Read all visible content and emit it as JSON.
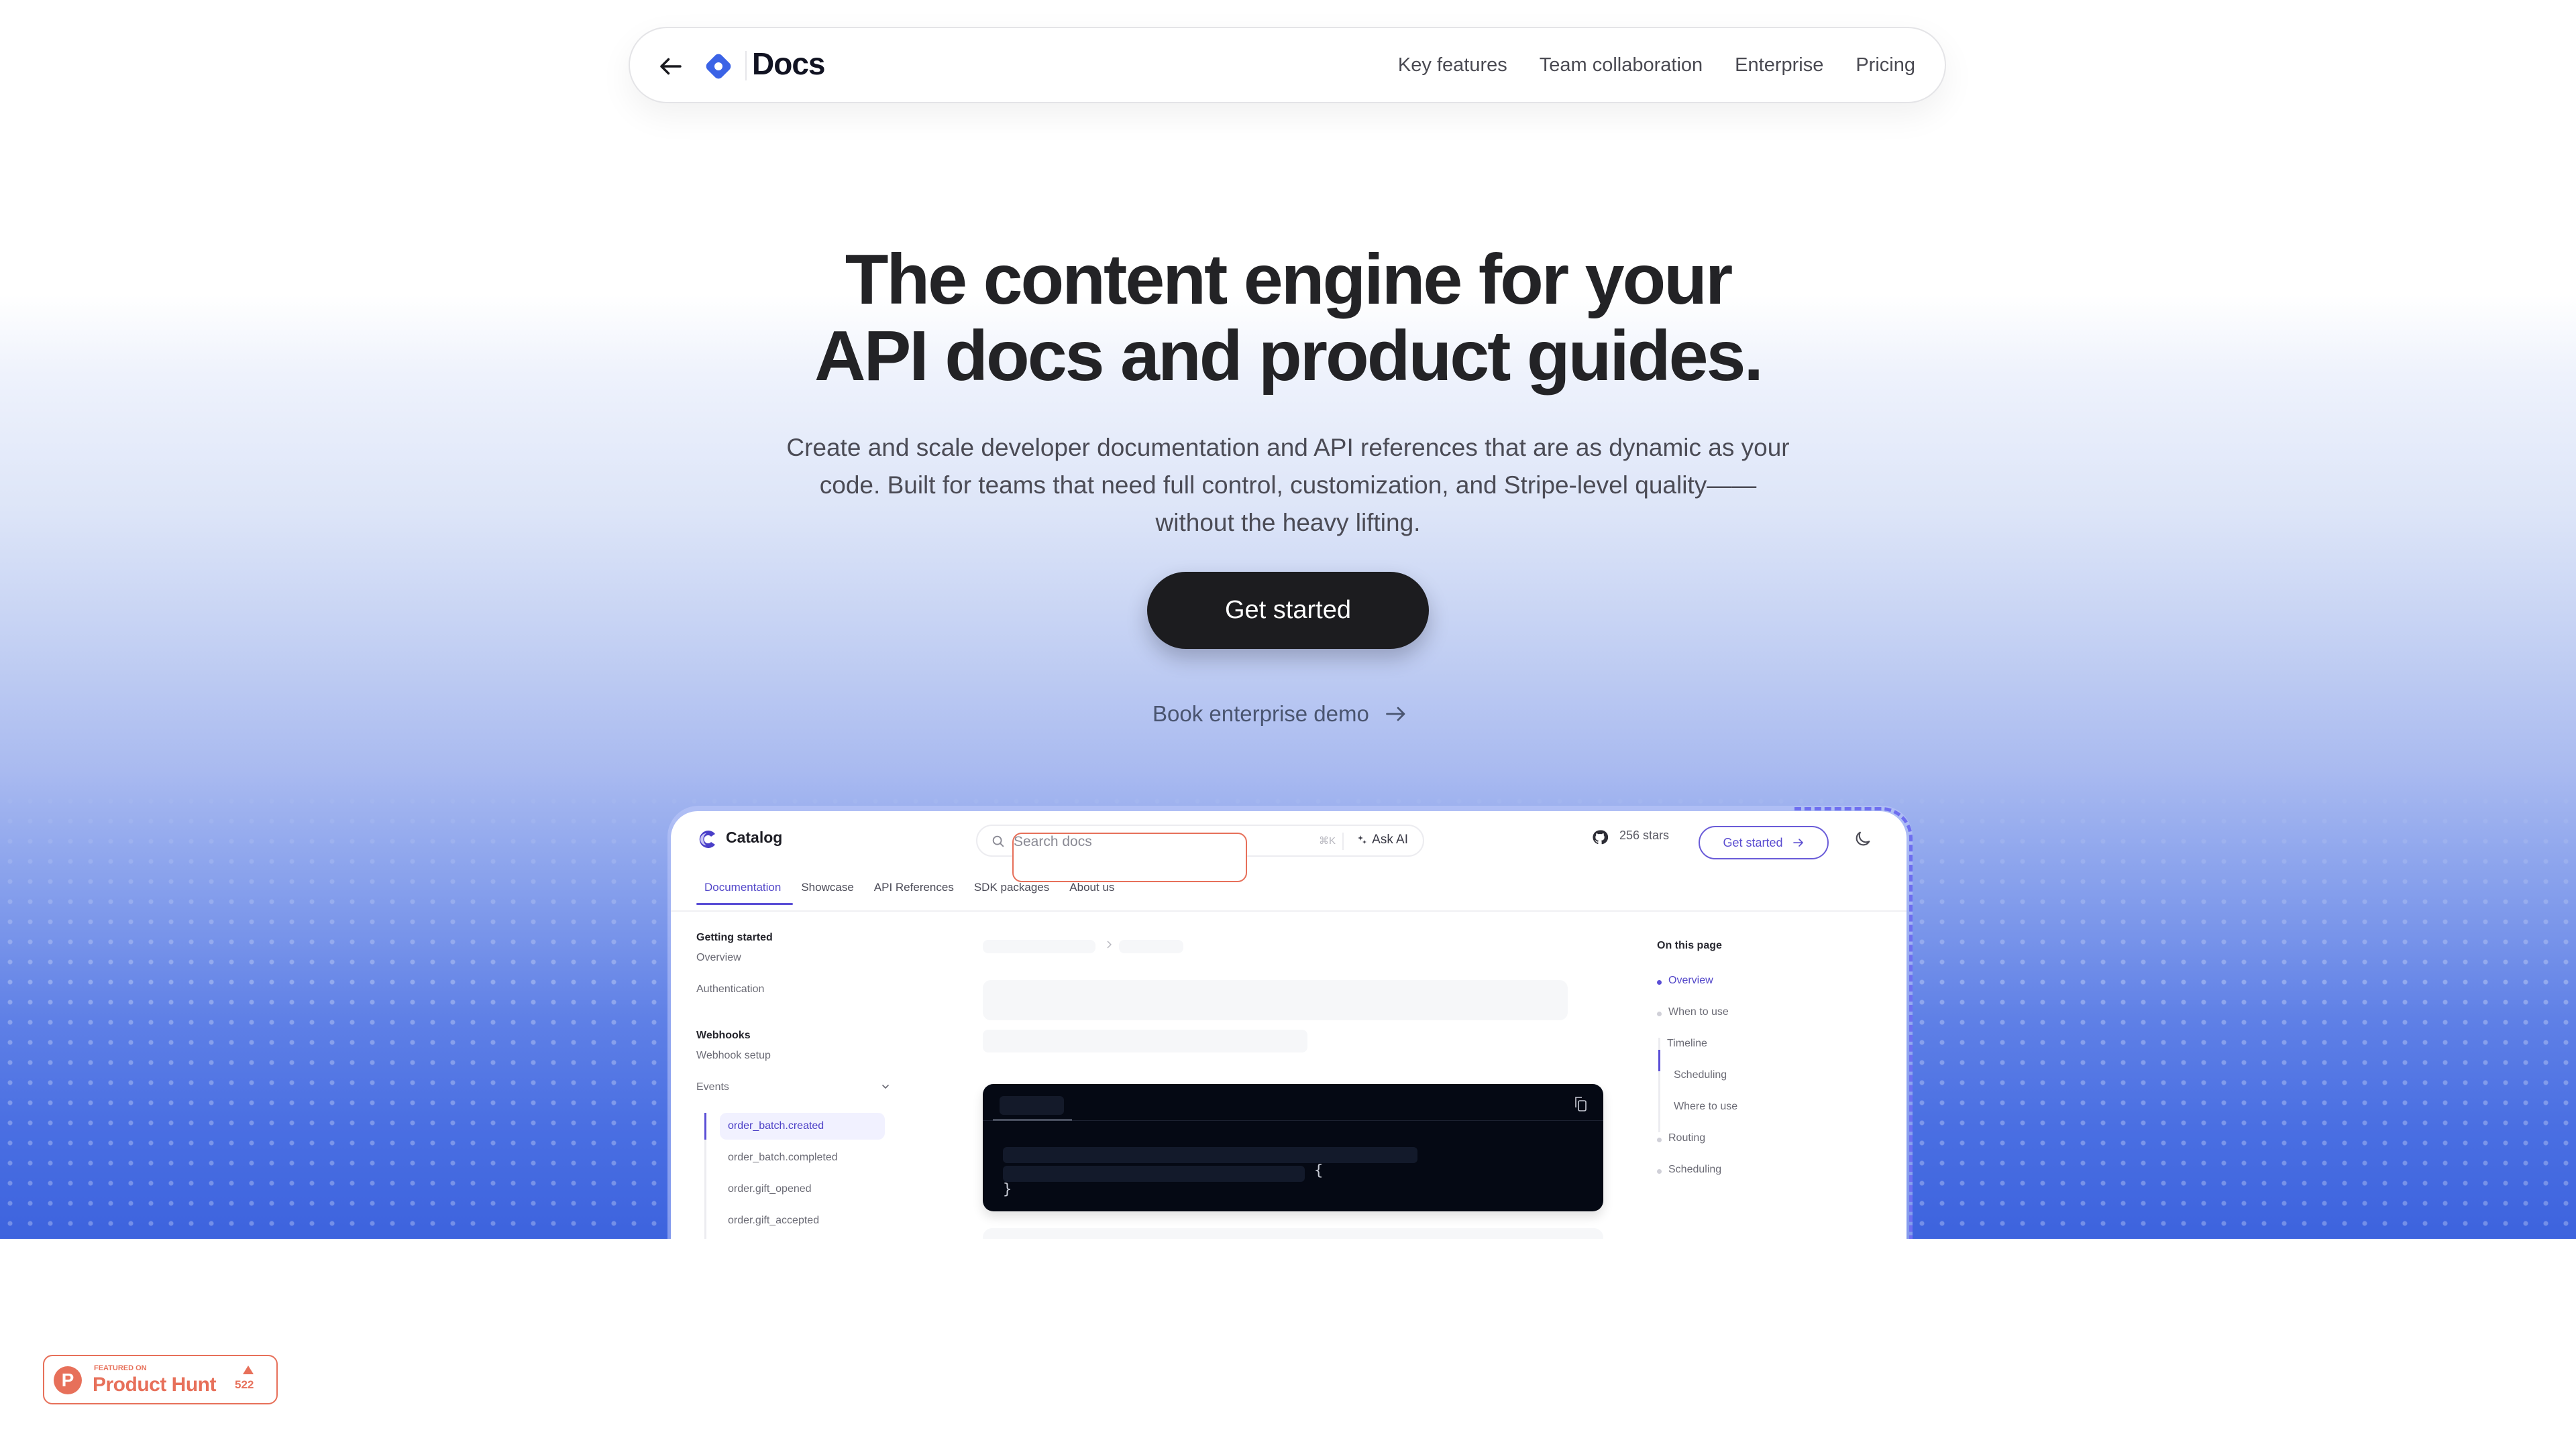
{
  "nav": {
    "brand": "Docs",
    "links": [
      "Key features",
      "Team collaboration",
      "Enterprise",
      "Pricing"
    ],
    "accent": "#3b63e6"
  },
  "hero": {
    "heading_line1": "The content engine for your",
    "heading_line2": "API docs and product guides.",
    "lead": "Create and scale developer documentation and API references that are as dynamic as your code. Built for teams that need full control, customization, and Stripe-level quality——without the heavy lifting.",
    "primary_cta": "Get started",
    "secondary_cta": "Book enterprise demo"
  },
  "mockup": {
    "brand": "Catalog",
    "search": {
      "placeholder": "Search docs",
      "shortcut": "⌘K",
      "ask_ai": "Ask AI"
    },
    "github_stars": "256 stars",
    "get_started": "Get started",
    "tabs": [
      {
        "label": "Documentation",
        "active": true
      },
      {
        "label": "Showcase",
        "active": false
      },
      {
        "label": "API References",
        "active": false
      },
      {
        "label": "SDK packages",
        "active": false
      },
      {
        "label": "About us",
        "active": false
      }
    ],
    "sidebar": {
      "groups": [
        {
          "title": "Getting started",
          "items": [
            "Overview",
            "Authentication"
          ]
        },
        {
          "title": "Webhooks",
          "items": [
            "Webhook setup",
            "Events"
          ]
        }
      ],
      "events_items": [
        {
          "label": "order_batch.created",
          "active": true
        },
        {
          "label": "order_batch.completed",
          "active": false
        },
        {
          "label": "order.gift_opened",
          "active": false
        },
        {
          "label": "order.gift_accepted",
          "active": false
        }
      ]
    },
    "code": {
      "open_brace": "{",
      "close_brace": "}"
    },
    "toc": {
      "title": "On this page",
      "items": [
        {
          "label": "Overview",
          "active": true
        },
        {
          "label": "When to use",
          "active": false
        },
        {
          "label": "Timeline",
          "active": false
        },
        {
          "label": "Scheduling",
          "active": false,
          "nested": true
        },
        {
          "label": "Where to use",
          "active": false,
          "nested": true
        },
        {
          "label": "Routing",
          "active": false
        },
        {
          "label": "Scheduling",
          "active": false
        }
      ]
    },
    "accent": "#5b4fd6"
  },
  "badge": {
    "featured_on": "FEATURED ON",
    "name": "Product Hunt",
    "votes": "522",
    "color": "#e7705a"
  }
}
